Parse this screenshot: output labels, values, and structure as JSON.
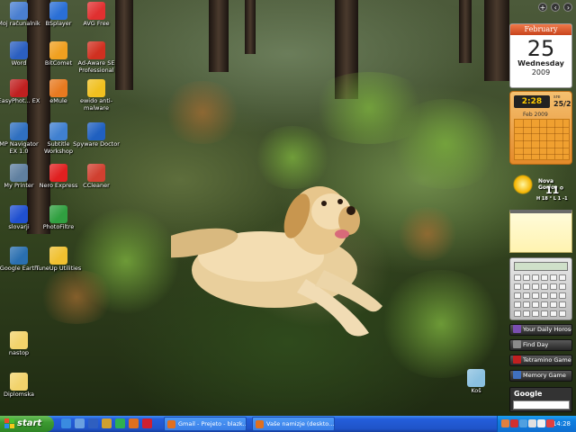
{
  "desktop": {
    "icons": [
      {
        "label": "Moj računalnik",
        "icon": "computer-icon",
        "color": "#4a7fd0"
      },
      {
        "label": "BSplayer",
        "icon": "bsplayer-icon",
        "color": "#2a6fd6"
      },
      {
        "label": "AVG Free",
        "icon": "avg-icon",
        "color": "#e03030"
      },
      {
        "label": "Word",
        "icon": "word-icon",
        "color": "#2b5fc0"
      },
      {
        "label": "BitComet",
        "icon": "bitcomet-icon",
        "color": "#f0a020"
      },
      {
        "label": "Ad-Aware SE Professional",
        "icon": "adaware-icon",
        "color": "#d03020"
      },
      {
        "label": "EasyPhot... EX",
        "icon": "easyphoto-icon",
        "color": "#c02020"
      },
      {
        "label": "eMule",
        "icon": "emule-icon",
        "color": "#e87a20"
      },
      {
        "label": "ewido anti-malware",
        "icon": "ewido-icon",
        "color": "#f0c020"
      },
      {
        "label": "MP Navigator EX 1.0",
        "icon": "mpnavigator-icon",
        "color": "#3070c0"
      },
      {
        "label": "Subtitle Workshop",
        "icon": "subtitle-icon",
        "color": "#4080d0"
      },
      {
        "label": "Spyware Doctor",
        "icon": "spyware-icon",
        "color": "#2060c0"
      },
      {
        "label": "My Printer",
        "icon": "printer-icon",
        "color": "#6080a0"
      },
      {
        "label": "Nero Express",
        "icon": "nero-icon",
        "color": "#e02020"
      },
      {
        "label": "CCleaner",
        "icon": "ccleaner-icon",
        "color": "#d04030"
      },
      {
        "label": "slovarji",
        "icon": "slovarji-icon",
        "color": "#2050d0"
      },
      {
        "label": "PhotoFiltre",
        "icon": "photofiltre-icon",
        "color": "#30a040"
      },
      {
        "label": "Google Earth",
        "icon": "google-earth-icon",
        "color": "#2a6fb0"
      },
      {
        "label": "TuneUp Utilities",
        "icon": "tuneup-icon",
        "color": "#f0c030"
      },
      {
        "label": "nastop",
        "icon": "folder-icon",
        "color": "#f2d36b"
      },
      {
        "label": "Diplomska",
        "icon": "folder-icon",
        "color": "#f2d36b"
      },
      {
        "label": "Koš",
        "icon": "recycle-bin-icon",
        "color": "#8ac0e0"
      }
    ]
  },
  "gadgets": {
    "controls": {
      "add": "+",
      "prev": "‹",
      "next": "›"
    },
    "calendar": {
      "month": "February",
      "day": "25",
      "weekday": "Wednesday",
      "year": "2009"
    },
    "clock_calendar": {
      "time": "2:28",
      "small": "sre",
      "date": "25/2",
      "month_label": "Feb 2009"
    },
    "weather": {
      "city": "Nova Gorica",
      "temp": "11°",
      "hilo": "H 18 ° L 1 -1"
    },
    "bars": [
      {
        "label": "Your Daily Horoscopes",
        "icon": "horoscope-icon",
        "color": "#7a4fb0"
      },
      {
        "label": "Find Day",
        "icon": "find-day-icon",
        "color": "#8a8a8a"
      },
      {
        "label": "Tetramino Game",
        "icon": "tetramino-icon",
        "color": "#c02020"
      },
      {
        "label": "Memory Game",
        "icon": "memory-icon",
        "color": "#4070c0"
      }
    ],
    "google": {
      "logo": "Google"
    }
  },
  "taskbar": {
    "start_label": "start",
    "quick_launch": [
      {
        "icon": "ie-icon",
        "color": "#3a8be0"
      },
      {
        "icon": "show-desktop-icon",
        "color": "#6aa0e0"
      },
      {
        "icon": "outlook-icon",
        "color": "#2f5fc0"
      },
      {
        "icon": "winamp-icon",
        "color": "#d0a030"
      },
      {
        "icon": "messenger-icon",
        "color": "#2fb050"
      },
      {
        "icon": "firefox-icon",
        "color": "#e07020"
      },
      {
        "icon": "opera-icon",
        "color": "#d02030"
      }
    ],
    "tasks": [
      {
        "label": "Gmail - Prejeto - blazk...",
        "icon": "firefox-icon",
        "color": "#e07020"
      },
      {
        "label": "Vaše namizje (deskto...",
        "icon": "firefox-icon",
        "color": "#e07020"
      }
    ],
    "tray": {
      "icons": [
        {
          "icon": "back-arrow-icon",
          "color": "#e08040"
        },
        {
          "icon": "antivirus-icon",
          "color": "#d03030"
        },
        {
          "icon": "network-icon",
          "color": "#50a0e0"
        },
        {
          "icon": "volume-icon",
          "color": "#e0e0e0"
        },
        {
          "icon": "mail-tray-icon",
          "color": "#f0f0f0"
        },
        {
          "icon": "security-icon",
          "color": "#e04040"
        }
      ],
      "time": "14:28"
    }
  }
}
